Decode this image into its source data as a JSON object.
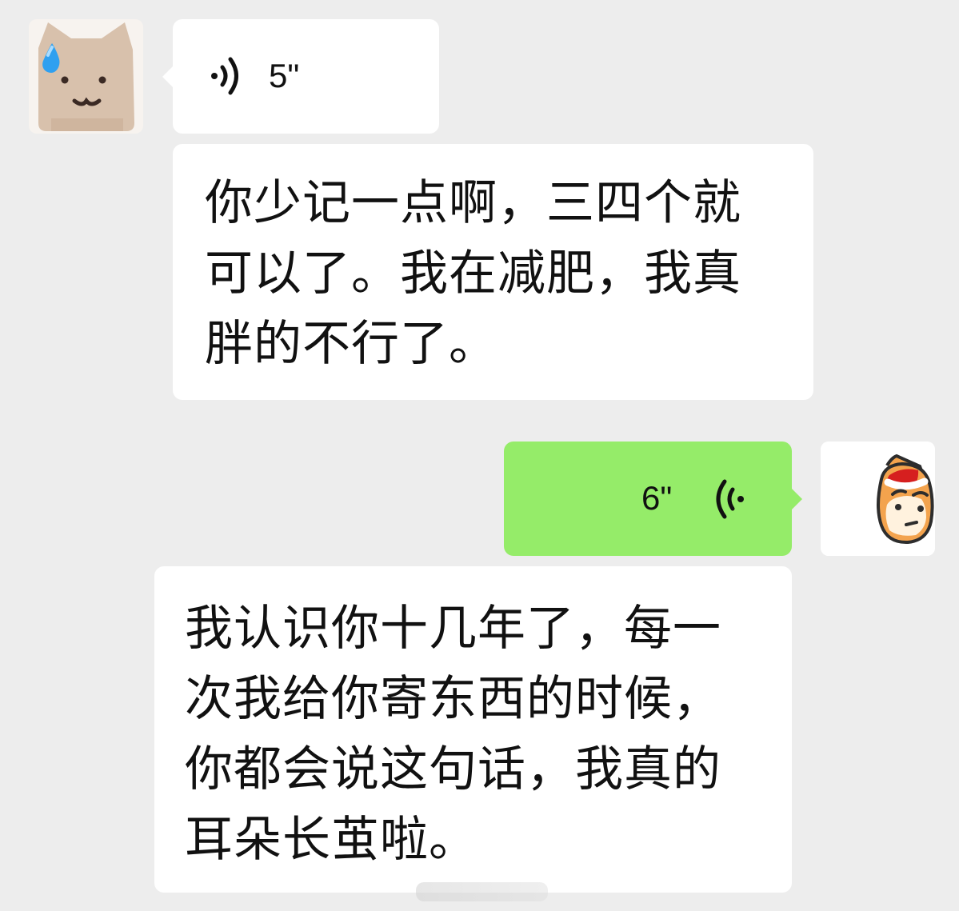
{
  "messages": [
    {
      "side": "left",
      "type": "voice",
      "duration": "5\""
    },
    {
      "side": "left",
      "type": "text",
      "text": "你少记一点啊，三四个就可以了。我在减肥，我真胖的不行了。"
    },
    {
      "side": "right",
      "type": "voice",
      "duration": "6\""
    },
    {
      "side": "left",
      "type": "text",
      "text": "我认识你十几年了，每一次我给你寄东西的时候，你都会说这句话，我真的耳朵长茧啦。"
    }
  ],
  "avatars": {
    "left": "crying-cat-avatar",
    "right": "santa-cat-avatar"
  },
  "colors": {
    "background": "#ededed",
    "incoming_bubble": "#ffffff",
    "outgoing_bubble": "#95ec69",
    "text": "#111111"
  }
}
